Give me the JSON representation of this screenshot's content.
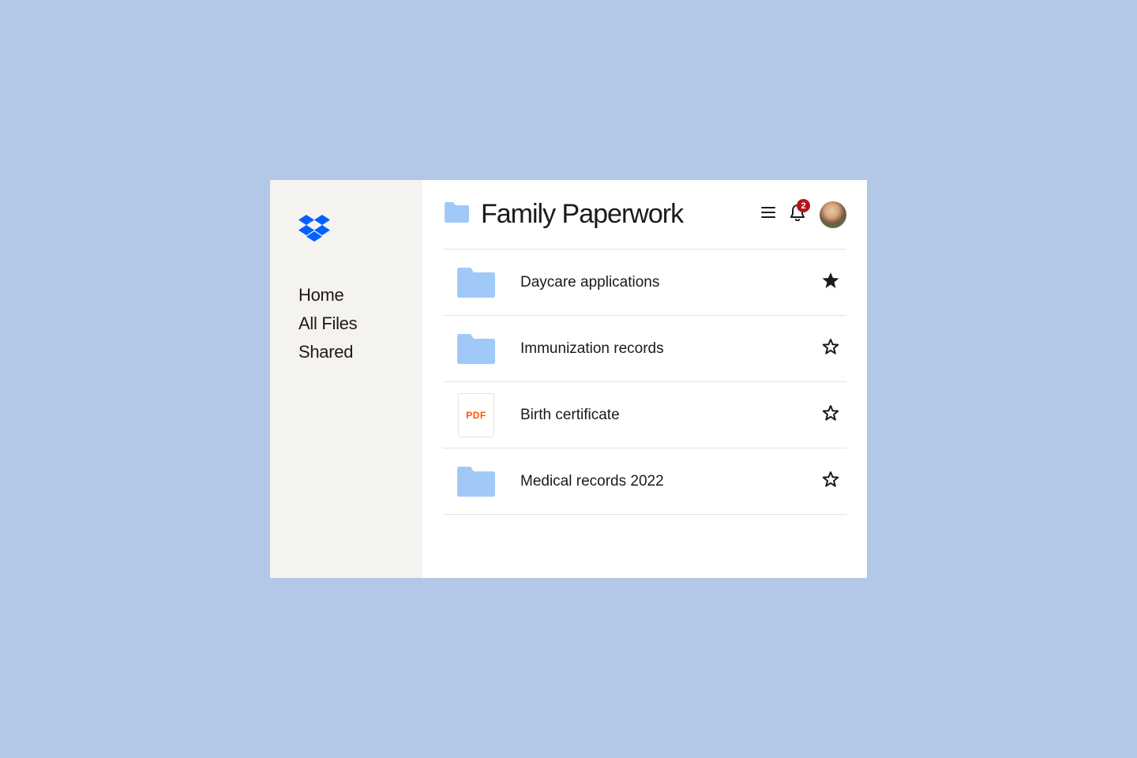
{
  "sidebar": {
    "nav": [
      {
        "label": "Home"
      },
      {
        "label": "All Files"
      },
      {
        "label": "Shared"
      }
    ]
  },
  "header": {
    "title": "Family Paperwork",
    "notification_count": "2"
  },
  "files": [
    {
      "name": "Daycare applications",
      "type": "folder",
      "starred": true
    },
    {
      "name": "Immunization records",
      "type": "folder",
      "starred": false
    },
    {
      "name": "Birth certificate",
      "type": "pdf",
      "starred": false,
      "pdf_label": "PDF"
    },
    {
      "name": "Medical records 2022",
      "type": "folder",
      "starred": false
    }
  ]
}
